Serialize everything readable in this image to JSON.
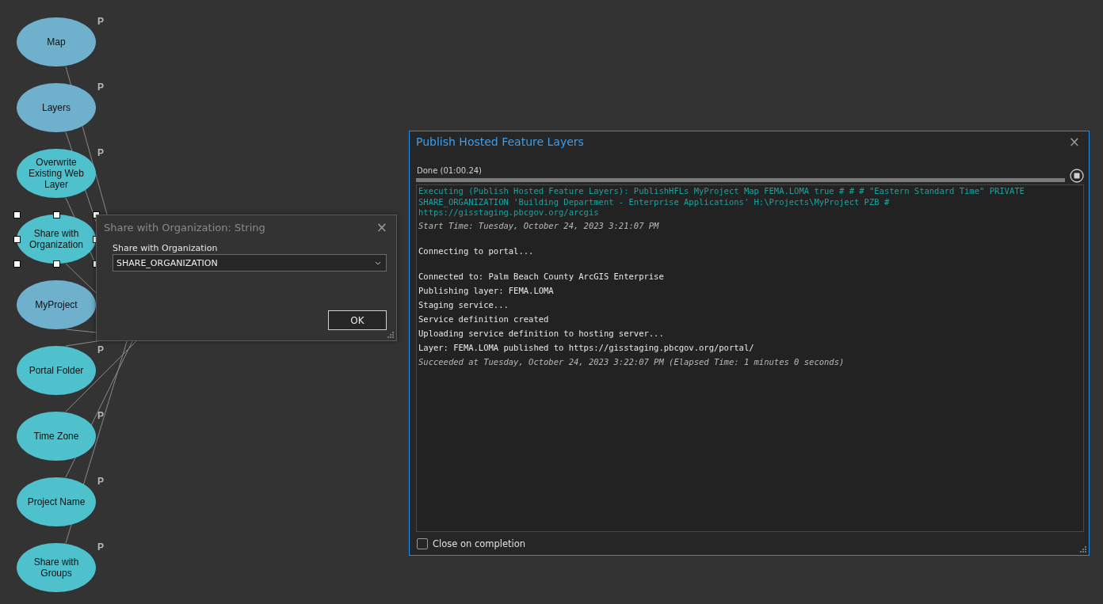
{
  "model": {
    "nodes": [
      {
        "label": "Map",
        "kind": "variable",
        "badge": "P",
        "selected": false
      },
      {
        "label": "Layers",
        "kind": "variable",
        "badge": "P",
        "selected": false
      },
      {
        "label": "Overwrite Existing Web Layer",
        "kind": "parameter",
        "badge": "P",
        "selected": false
      },
      {
        "label": "Share with Organization",
        "kind": "parameter",
        "selected": true
      },
      {
        "label": "MyProject",
        "kind": "variable",
        "selected": false
      },
      {
        "label": "Portal Folder",
        "kind": "parameter",
        "badge": "P",
        "selected": false
      },
      {
        "label": "Time Zone",
        "kind": "parameter",
        "badge": "P",
        "selected": false
      },
      {
        "label": "Project Name",
        "kind": "parameter",
        "badge": "P",
        "selected": false
      },
      {
        "label": "Share with Groups",
        "kind": "parameter",
        "badge": "P",
        "selected": false
      }
    ]
  },
  "value_dialog": {
    "title": "Share with Organization: String",
    "close": "×",
    "field_label": "Share with Organization",
    "value": "SHARE_ORGANIZATION",
    "ok": "OK"
  },
  "progress_window": {
    "title": "Publish Hosted Feature Layers",
    "close": "×",
    "status": "Done (01:00.24)",
    "level": 1,
    "log": [
      {
        "lines": [
          {
            "kind": "command",
            "text": "Executing (Publish Hosted Feature Layers): PublishHFLs MyProject Map FEMA.LOMA true # # # \"Eastern Standard Time\" PRIVATE SHARE_ORGANIZATION 'Building Department - Enterprise Applications' H:\\Projects\\MyProject PZB # https://gisstaging.pbcgov.org/arcgis"
          },
          {
            "kind": "time",
            "text": "Start Time: Tuesday, October 24, 2023 3:21:07 PM"
          }
        ]
      },
      {
        "lines": [
          {
            "kind": "message",
            "text": "Connecting to portal..."
          }
        ]
      },
      {
        "lines": [
          {
            "kind": "message",
            "text": "Connected to: Palm Beach County ArcGIS Enterprise"
          },
          {
            "kind": "message",
            "text": "Publishing layer: FEMA.LOMA"
          },
          {
            "kind": "message",
            "text": "Staging service..."
          },
          {
            "kind": "message",
            "text": "Service definition created"
          },
          {
            "kind": "message",
            "text": "Uploading service definition to hosting server..."
          },
          {
            "kind": "message",
            "text": "Layer: FEMA.LOMA published to https://gisstaging.pbcgov.org/portal/"
          },
          {
            "kind": "time",
            "text": "Succeeded at Tuesday, October 24, 2023 3:22:07 PM (Elapsed Time: 1 minutes 0 seconds)"
          }
        ]
      }
    ],
    "close_on_completion": {
      "label": "Close on completion",
      "checked": false
    }
  }
}
